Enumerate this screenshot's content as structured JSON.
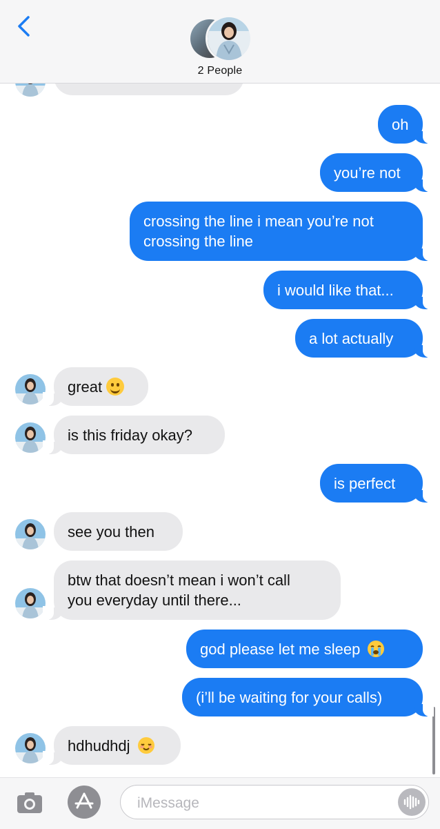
{
  "header": {
    "back_icon": "chevron-left-icon",
    "title": "2 People",
    "accent": "#1b7cf3"
  },
  "messages": [
    {
      "from": "me",
      "text": "oh"
    },
    {
      "from": "me",
      "text": "you’re not"
    },
    {
      "from": "me",
      "lines": [
        "crossing the line i mean you’re not",
        "crossing the line"
      ]
    },
    {
      "from": "me",
      "text": "i would like that..."
    },
    {
      "from": "me",
      "text": "a lot actually"
    },
    {
      "from": "them",
      "text": "great",
      "emoji": "grinning-face"
    },
    {
      "from": "them",
      "text": "is this friday okay?"
    },
    {
      "from": "me",
      "text": "is perfect"
    },
    {
      "from": "them",
      "text": "see you then"
    },
    {
      "from": "them",
      "lines": [
        "btw that doesn’t mean i won’t call",
        "you everyday until there..."
      ]
    },
    {
      "from": "me",
      "text": "god please let me sleep",
      "emoji": "loudly-crying-face"
    },
    {
      "from": "me",
      "text": "(i’ll be waiting for your calls)"
    },
    {
      "from": "them",
      "text": "hdhudhdj",
      "emoji": "smiling-face"
    }
  ],
  "input_bar": {
    "camera_icon": "camera-icon",
    "apps_icon": "app-store-icon",
    "placeholder": "iMessage",
    "audio_icon": "audio-waveform-icon"
  },
  "colors": {
    "outgoing_bubble": "#1b7cf3",
    "incoming_bubble": "#e9e9eb",
    "header_bg": "#f6f6f7"
  }
}
